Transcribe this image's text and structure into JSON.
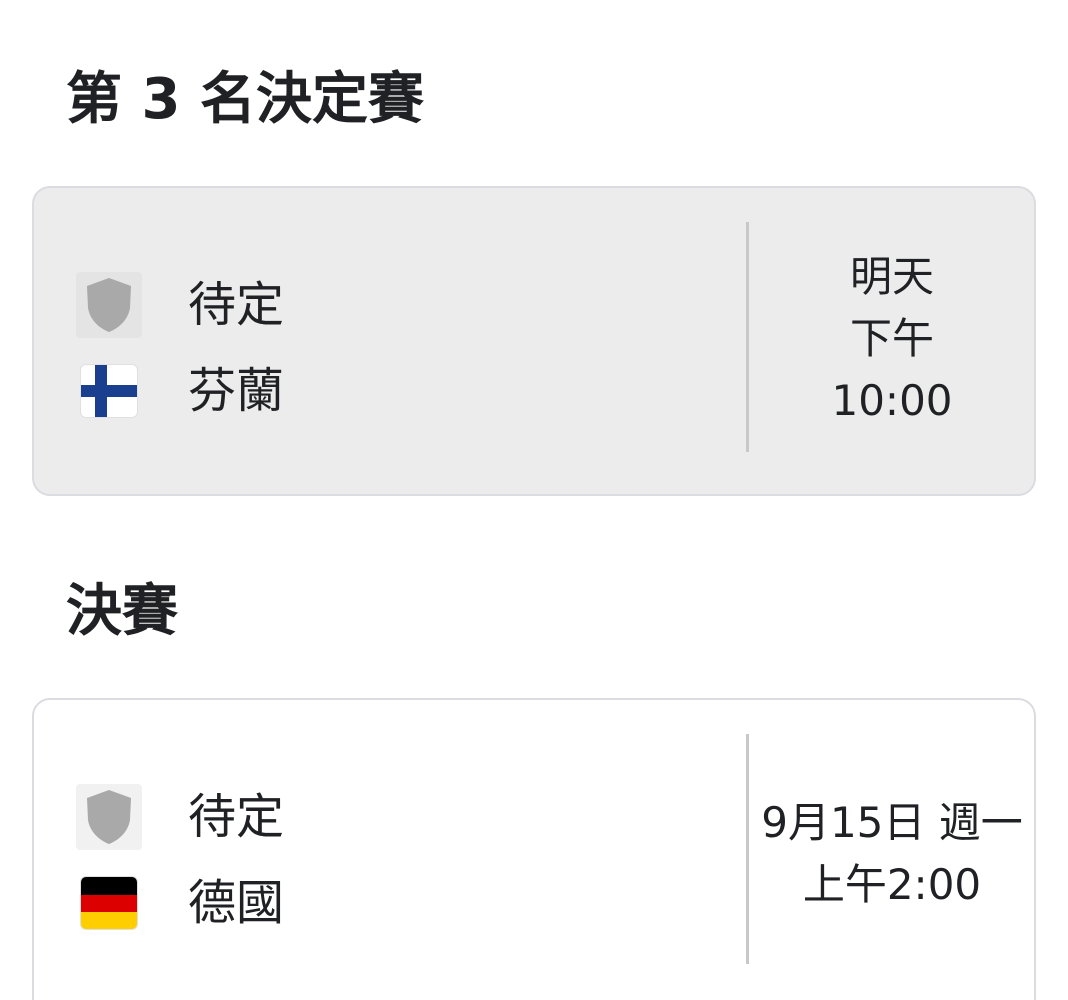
{
  "sections": [
    {
      "title": "第 3 名決定賽",
      "match": {
        "home": {
          "name": "待定",
          "icon": "placeholder-shield-icon"
        },
        "away": {
          "name": "芬蘭",
          "icon": "finland-flag-icon"
        },
        "time_lines": [
          "明天",
          "下午",
          "10:00"
        ]
      }
    },
    {
      "title": "決賽",
      "match": {
        "home": {
          "name": "待定",
          "icon": "placeholder-shield-icon"
        },
        "away": {
          "name": "德國",
          "icon": "germany-flag-icon"
        },
        "time_lines": [
          "9月15日 週一",
          "上午2:00"
        ]
      }
    }
  ],
  "colors": {
    "highlight_card_bg": "#ececec",
    "card_border": "#dadce0",
    "shield_gray": "#a9a9a9",
    "finland_blue": "#1a3f8f",
    "germany_black": "#000000",
    "germany_red": "#dd0000",
    "germany_gold": "#ffce00"
  }
}
